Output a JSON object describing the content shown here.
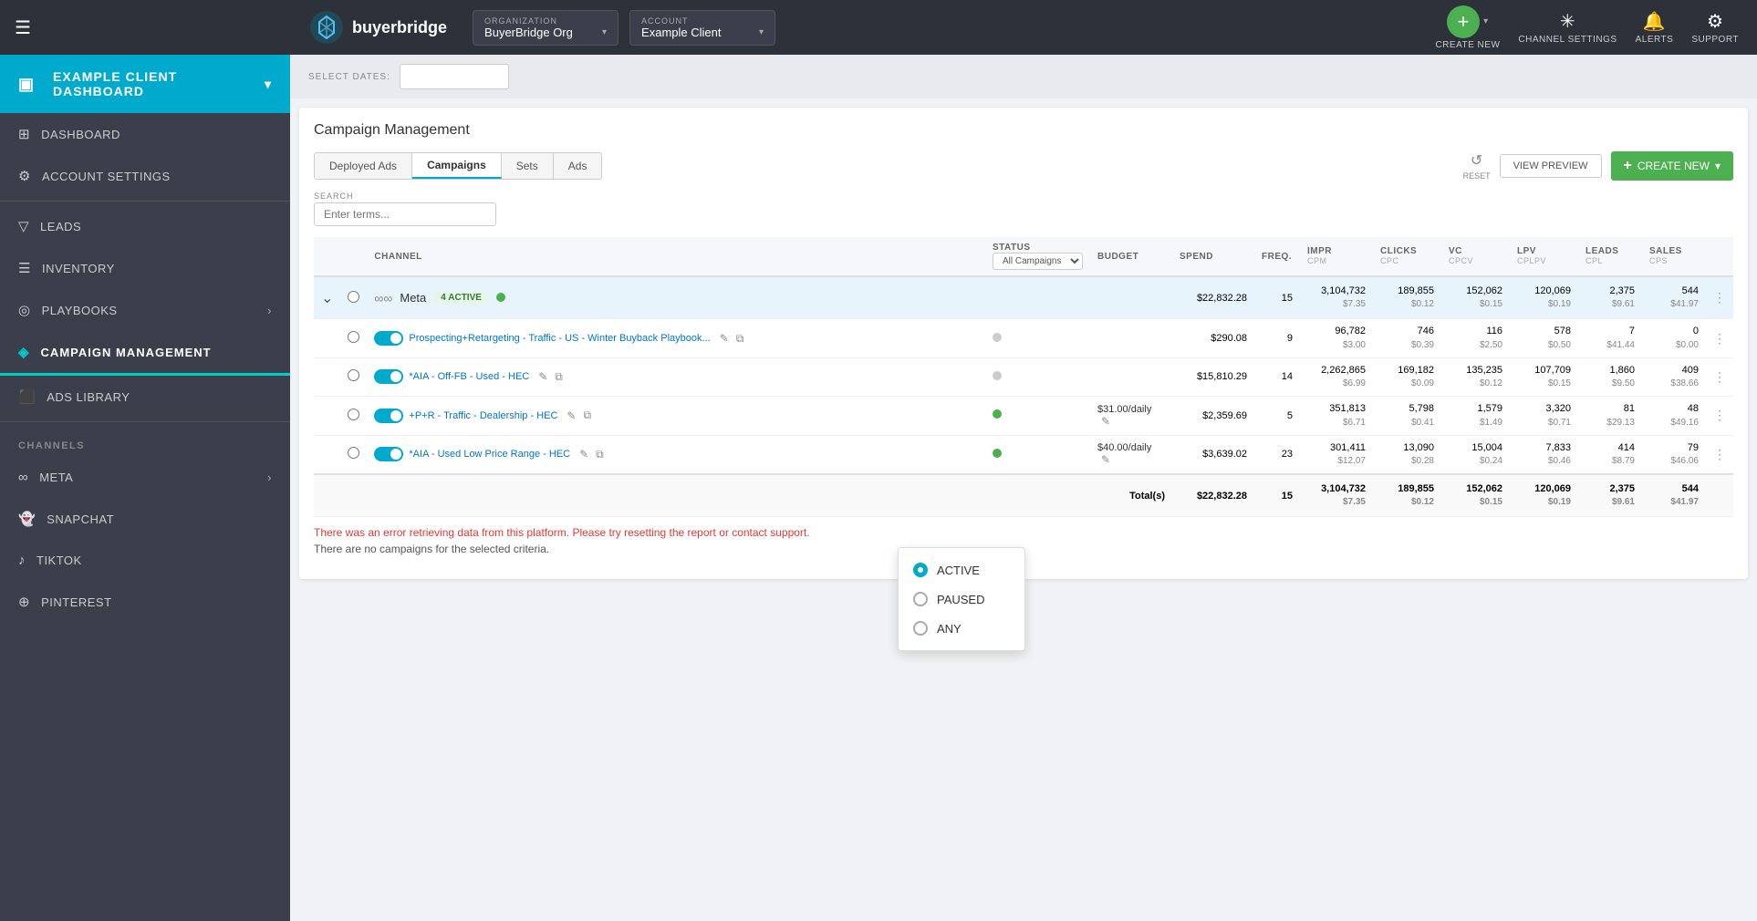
{
  "app": {
    "logo_text_regular": "buyer",
    "logo_text_bold": "bridge"
  },
  "topnav": {
    "organization_label": "ORGANIZATION",
    "organization_value": "BuyerBridge Org",
    "account_label": "ACCOUNT",
    "account_value": "Example Client",
    "create_new_label": "CREATE NEW",
    "channel_settings_label": "CHANNEL SETTINGS",
    "alerts_label": "ALERTS",
    "support_label": "SUPPORT"
  },
  "sidebar": {
    "dashboard_item": "EXAMPLE CLIENT DASHBOARD",
    "dashboard_icon": "▣",
    "items": [
      {
        "label": "DASHBOARD",
        "icon": "⊞"
      },
      {
        "label": "ACCOUNT SETTINGS",
        "icon": "⚙"
      },
      {
        "label": "LEADS",
        "icon": "▽"
      },
      {
        "label": "INVENTORY",
        "icon": "☰"
      },
      {
        "label": "PLAYBOOKS",
        "icon": "◎"
      },
      {
        "label": "CAMPAIGN MANAGEMENT",
        "icon": "◈",
        "active": true
      },
      {
        "label": "ADS LIBRARY",
        "icon": "⬛"
      }
    ],
    "section_channels": "CHANNELS",
    "channels": [
      {
        "label": "META",
        "icon": "∞"
      },
      {
        "label": "SNAPCHAT",
        "icon": "👻"
      },
      {
        "label": "TIKTOK",
        "icon": "♪"
      },
      {
        "label": "PINTEREST",
        "icon": "⊕"
      }
    ]
  },
  "content": {
    "date_select_label": "SELECT DATES:",
    "campaign_mgmt_title": "Campaign Management",
    "tabs": [
      {
        "label": "Deployed Ads",
        "active": false
      },
      {
        "label": "Campaigns",
        "active": true
      },
      {
        "label": "Sets",
        "active": false
      },
      {
        "label": "Ads",
        "active": false
      }
    ],
    "reset_label": "RESET",
    "view_preview_label": "VIEW PREVIEW",
    "create_new_label": "CREATE NEW",
    "search_label": "Search",
    "search_placeholder": "Enter terms...",
    "table": {
      "headers": [
        {
          "label": "CHANNEL",
          "sub": ""
        },
        {
          "label": "STATUS",
          "sub": ""
        },
        {
          "label": "BUDGET",
          "sub": ""
        },
        {
          "label": "SPEND",
          "sub": ""
        },
        {
          "label": "FREQ.",
          "sub": ""
        },
        {
          "label": "IMPR",
          "sub": "CPM"
        },
        {
          "label": "CLICKS",
          "sub": "CPC"
        },
        {
          "label": "VC",
          "sub": "CPCV"
        },
        {
          "label": "LPV",
          "sub": "CPLPV"
        },
        {
          "label": "LEADS",
          "sub": "CPL"
        },
        {
          "label": "SALES",
          "sub": "CPS"
        }
      ],
      "meta_group": {
        "channel": "Meta",
        "active_count": "4 ACTIVE",
        "spend": "$22,832.28",
        "freq": "15",
        "impr": "3,104,732",
        "impr_cpm": "$7.35",
        "clicks": "189,855",
        "clicks_cpc": "$0.12",
        "vc": "152,062",
        "vc_cpcv": "$0.15",
        "lpv": "120,069",
        "lpv_cplpv": "$0.19",
        "leads": "2,375",
        "leads_cpl": "$9.61",
        "sales": "544",
        "sales_cps": "$41.97"
      },
      "campaigns": [
        {
          "name": "Prospecting+Retargeting - Traffic - US - Winter Buyback Playbook...",
          "status_color": "gray",
          "budget": "",
          "budget_daily": "",
          "spend": "$290.08",
          "freq": "9",
          "impr": "96,782",
          "impr_cpm": "$3.00",
          "clicks": "746",
          "clicks_cpc": "$0.39",
          "vc": "116",
          "vc_cpcv": "$2.50",
          "lpv": "578",
          "lpv_cplpv": "$0.50",
          "leads": "7",
          "leads_cpl": "$41.44",
          "sales": "0",
          "sales_cps": "$0.00"
        },
        {
          "name": "*AIA - Off-FB - Used - HEC",
          "status_color": "gray",
          "budget": "",
          "budget_daily": "",
          "spend": "$15,810.29",
          "freq": "14",
          "impr": "2,262,865",
          "impr_cpm": "$6.99",
          "clicks": "169,182",
          "clicks_cpc": "$0.09",
          "vc": "135,235",
          "vc_cpcv": "$0.12",
          "lpv": "107,709",
          "lpv_cplpv": "$0.15",
          "leads": "1,860",
          "leads_cpl": "$9.50",
          "sales": "409",
          "sales_cps": "$38.66"
        },
        {
          "name": "+P+R - Traffic - Dealership - HEC",
          "status_color": "green",
          "budget": "$31.00/daily",
          "spend": "$2,359.69",
          "freq": "5",
          "impr": "351,813",
          "impr_cpm": "$6.71",
          "clicks": "5,798",
          "clicks_cpc": "$0.41",
          "vc": "1,579",
          "vc_cpcv": "$1.49",
          "lpv": "3,320",
          "lpv_cplpv": "$0.71",
          "leads": "81",
          "leads_cpl": "$29.13",
          "sales": "48",
          "sales_cps": "$49.16"
        },
        {
          "name": "*AIA - Used Low Price Range - HEC",
          "status_color": "green",
          "budget": "$40.00/daily",
          "spend": "$3,639.02",
          "freq": "23",
          "impr": "301,411",
          "impr_cpm": "$12.07",
          "clicks": "13,090",
          "clicks_cpc": "$0.28",
          "vc": "15,004",
          "vc_cpcv": "$0.24",
          "lpv": "7,833",
          "lpv_cplpv": "$0.46",
          "leads": "414",
          "leads_cpl": "$8.79",
          "sales": "79",
          "sales_cps": "$46.06"
        }
      ],
      "totals": {
        "label": "Total(s)",
        "spend": "$22,832.28",
        "freq": "15",
        "impr": "3,104,732",
        "impr_cpm": "$7.35",
        "clicks": "189,855",
        "clicks_cpc": "$0.12",
        "vc": "152,062",
        "vc_cpcv": "$0.15",
        "lpv": "120,069",
        "lpv_cplpv": "$0.19",
        "leads": "2,375",
        "leads_cpl": "$9.61",
        "sales": "544",
        "sales_cps": "$41.97"
      }
    },
    "error_text": "There was an error retrieving data from this platform. Please try resetting the report or contact support.",
    "no_campaigns_text": "There are no campaigns for the selected criteria.",
    "status_popup": {
      "options": [
        "ACTIVE",
        "PAUSED",
        "ANY"
      ],
      "selected": "ACTIVE"
    }
  }
}
